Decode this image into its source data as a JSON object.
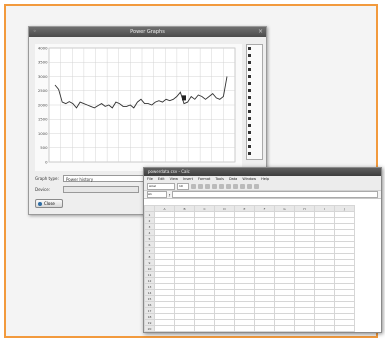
{
  "window1": {
    "title": "Power Graphs",
    "graph_type_label": "Graph type:",
    "graph_type_value": "Power history",
    "device_label": "Device:",
    "button_label": "Close",
    "legend": [
      "",
      "",
      "",
      "",
      "",
      "",
      "",
      "",
      "",
      "",
      "",
      "",
      "",
      "",
      "",
      ""
    ]
  },
  "chart_data": {
    "type": "line",
    "y_ticks": [
      "4000",
      "3500",
      "3000",
      "2500",
      "2000",
      "1500",
      "1000",
      "500",
      "0"
    ],
    "ylim": [
      0,
      4000
    ],
    "x_ticks": [
      "",
      "",
      "",
      "",
      "",
      "",
      "",
      "",
      "",
      "",
      "",
      "",
      "",
      "",
      "",
      "",
      ""
    ],
    "series": [
      {
        "values": [
          2700,
          2550,
          2100,
          2050,
          2120,
          2050,
          1900,
          2100,
          2050,
          2000,
          1950,
          1900,
          1980,
          2050,
          1950,
          2000,
          1900,
          2100,
          2050,
          1950,
          1950,
          2000,
          1900,
          2100,
          2200,
          2050,
          2050,
          2000,
          2100,
          2150,
          2100,
          2200,
          2150,
          2200,
          2300,
          2450,
          2050,
          2100,
          2300,
          2200,
          2350,
          2300,
          2200,
          2300,
          2400,
          2250,
          2200,
          2300,
          3000
        ]
      }
    ],
    "marker_value": 2250
  },
  "window2": {
    "title": "powerdata.csv - Calc",
    "menu": [
      "File",
      "Edit",
      "View",
      "Insert",
      "Format",
      "Tools",
      "Data",
      "Window",
      "Help"
    ],
    "font_name": "Arial",
    "font_size": "10",
    "cell_ref": "A1",
    "columns": [
      "",
      "A",
      "B",
      "C",
      "D",
      "E",
      "F",
      "G",
      "H",
      "I",
      "J"
    ],
    "rows": [
      [
        "1",
        "",
        "",
        "",
        "",
        "",
        "",
        "",
        "",
        "",
        ""
      ],
      [
        "2",
        "",
        "",
        "",
        "",
        "",
        "",
        "",
        "",
        "",
        ""
      ],
      [
        "3",
        "",
        "",
        "",
        "",
        "",
        "",
        "",
        "",
        "",
        ""
      ],
      [
        "4",
        "",
        "",
        "",
        "",
        "",
        "",
        "",
        "",
        "",
        ""
      ],
      [
        "5",
        "",
        "",
        "",
        "",
        "",
        "",
        "",
        "",
        "",
        ""
      ],
      [
        "6",
        "",
        "",
        "",
        "",
        "",
        "",
        "",
        "",
        "",
        ""
      ],
      [
        "7",
        "",
        "",
        "",
        "",
        "",
        "",
        "",
        "",
        "",
        ""
      ],
      [
        "8",
        "",
        "",
        "",
        "",
        "",
        "",
        "",
        "",
        "",
        ""
      ],
      [
        "9",
        "",
        "",
        "",
        "",
        "",
        "",
        "",
        "",
        "",
        ""
      ],
      [
        "10",
        "",
        "",
        "",
        "",
        "",
        "",
        "",
        "",
        "",
        ""
      ],
      [
        "11",
        "",
        "",
        "",
        "",
        "",
        "",
        "",
        "",
        "",
        ""
      ],
      [
        "12",
        "",
        "",
        "",
        "",
        "",
        "",
        "",
        "",
        "",
        ""
      ],
      [
        "13",
        "",
        "",
        "",
        "",
        "",
        "",
        "",
        "",
        "",
        ""
      ],
      [
        "14",
        "",
        "",
        "",
        "",
        "",
        "",
        "",
        "",
        "",
        ""
      ],
      [
        "15",
        "",
        "",
        "",
        "",
        "",
        "",
        "",
        "",
        "",
        ""
      ],
      [
        "16",
        "",
        "",
        "",
        "",
        "",
        "",
        "",
        "",
        "",
        ""
      ],
      [
        "17",
        "",
        "",
        "",
        "",
        "",
        "",
        "",
        "",
        "",
        ""
      ],
      [
        "18",
        "",
        "",
        "",
        "",
        "",
        "",
        "",
        "",
        "",
        ""
      ],
      [
        "19",
        "",
        "",
        "",
        "",
        "",
        "",
        "",
        "",
        "",
        ""
      ],
      [
        "20",
        "",
        "",
        "",
        "",
        "",
        "",
        "",
        "",
        "",
        ""
      ],
      [
        "21",
        "",
        "",
        "",
        "",
        "",
        "",
        "",
        "",
        "",
        ""
      ],
      [
        "22",
        "",
        "",
        "",
        "",
        "",
        "",
        "",
        "",
        "",
        ""
      ],
      [
        "23",
        "",
        "",
        "",
        "",
        "",
        "",
        "",
        "",
        "",
        ""
      ]
    ]
  }
}
